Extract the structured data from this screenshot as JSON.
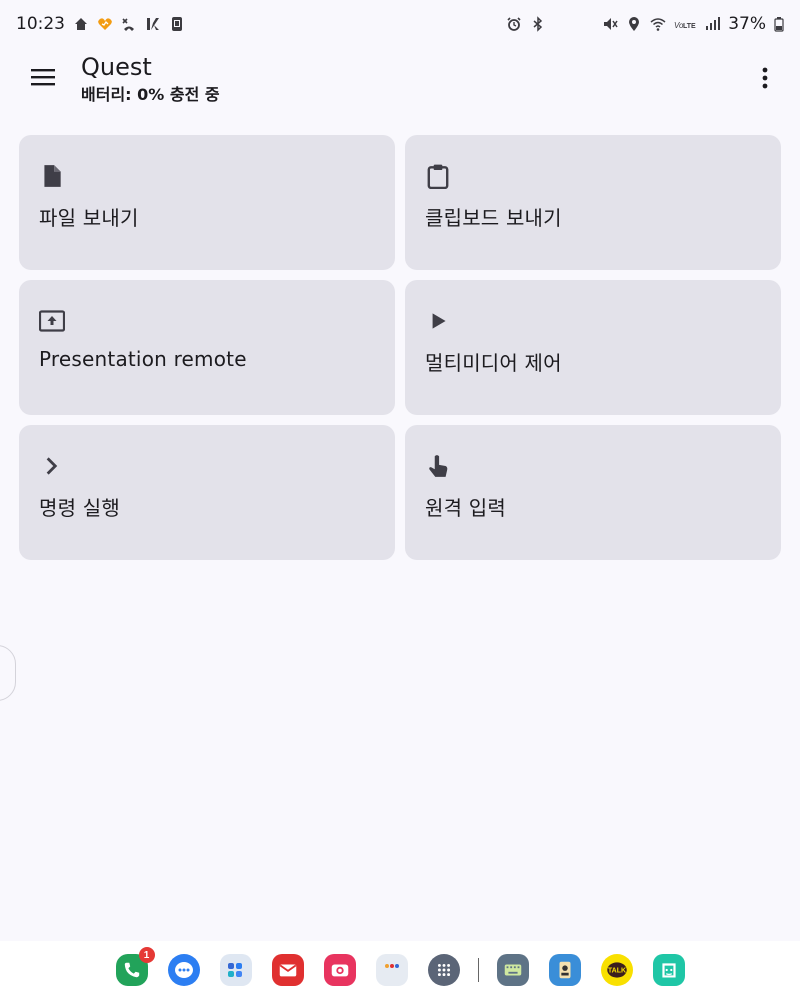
{
  "status_bar": {
    "time": "10:23",
    "battery_percent": "37%",
    "left_icons": [
      "home-notify-icon",
      "heart-notify-icon",
      "phone-missed-icon",
      "app-notify-icon",
      "screen-notify-icon"
    ],
    "right_icons": [
      "alarm-icon",
      "bluetooth-icon",
      "mute-icon",
      "location-icon",
      "wifi-icon",
      "volte-icon",
      "signal-icon",
      "battery-icon"
    ]
  },
  "app_bar": {
    "title": "Quest",
    "subtitle": "배터리: 0% 충전 중"
  },
  "cards": [
    {
      "label": "파일 보내기",
      "icon": "file-icon"
    },
    {
      "label": "클립보드 보내기",
      "icon": "clipboard-icon"
    },
    {
      "label": "Presentation remote",
      "icon": "presentation-icon"
    },
    {
      "label": "멀티미디어 제어",
      "icon": "play-icon"
    },
    {
      "label": "명령 실행",
      "icon": "chevron-right-icon"
    },
    {
      "label": "원격 입력",
      "icon": "touch-icon"
    }
  ],
  "dock": {
    "phone_badge": "1",
    "apps": [
      "phone-app",
      "messages-app",
      "folder-app",
      "mail-app",
      "camera-app",
      "folder2-app",
      "apps-drawer",
      "keyboard-app",
      "finder-app",
      "kakaotalk-app",
      "mi-home-app"
    ],
    "kakao_label": "TALK"
  },
  "colors": {
    "background": "#f9f8fd",
    "card": "#e3e2ea",
    "text": "#1c1b1f"
  }
}
